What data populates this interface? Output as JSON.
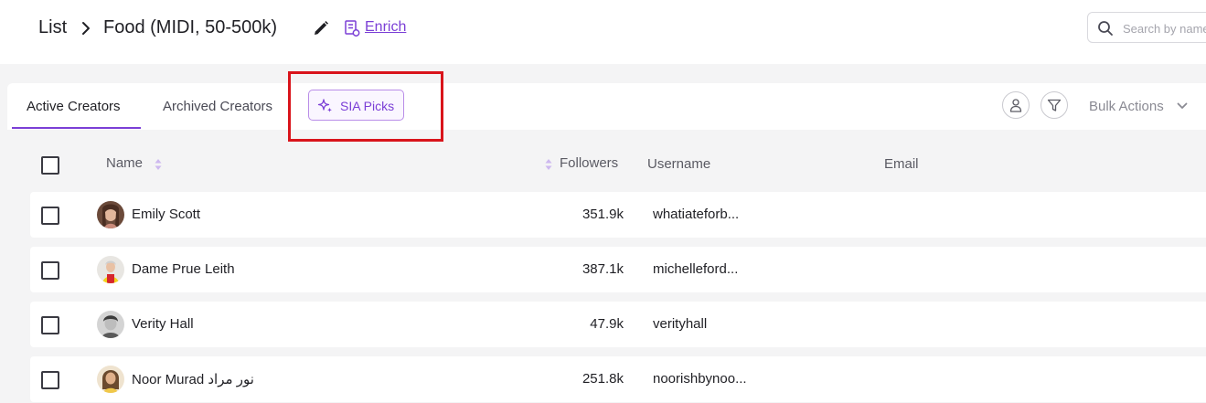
{
  "breadcrumb": {
    "root": "List",
    "title": "Food (MIDI, 50-500k)",
    "enrich_label": "Enrich"
  },
  "search": {
    "placeholder": "Search by name"
  },
  "tabs": [
    {
      "label": "Active Creators",
      "active": true
    },
    {
      "label": "Archived Creators",
      "active": false
    },
    {
      "label": "SIA Picks",
      "active": false
    }
  ],
  "toolbar": {
    "bulk_actions_label": "Bulk Actions"
  },
  "table": {
    "columns": {
      "name": "Name",
      "followers": "Followers",
      "username": "Username",
      "email": "Email"
    },
    "rows": [
      {
        "name": "Emily Scott",
        "followers": "351.9k",
        "username": "whatiateforb...",
        "email": ""
      },
      {
        "name": "Dame Prue Leith",
        "followers": "387.1k",
        "username": "michelleford...",
        "email": ""
      },
      {
        "name": "Verity Hall",
        "followers": "47.9k",
        "username": "verityhall",
        "email": ""
      },
      {
        "name": "Noor Murad نور مراد",
        "followers": "251.8k",
        "username": "noorishbynoo...",
        "email": ""
      }
    ]
  },
  "colors": {
    "accent": "#7b3fd6",
    "highlight": "#d9141b"
  }
}
